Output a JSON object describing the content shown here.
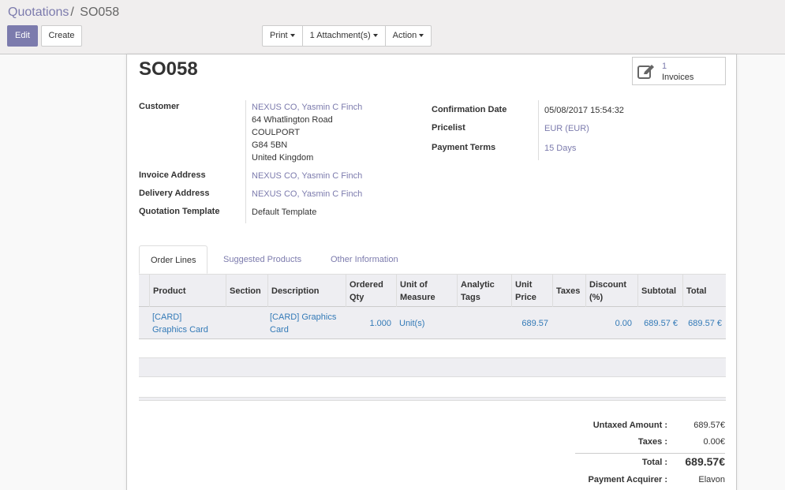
{
  "breadcrumb": {
    "parent": "Quotations",
    "separator": "/",
    "current": "SO058"
  },
  "toolbar": {
    "edit": "Edit",
    "create": "Create",
    "print": "Print",
    "attachments": "1 Attachment(s)",
    "action": "Action"
  },
  "record": {
    "title": "SO058",
    "stat_invoices_count": "1",
    "stat_invoices_label": "Invoices"
  },
  "left_fields": {
    "customer_label": "Customer",
    "customer_name": "NEXUS CO, Yasmin C Finch",
    "address_line1": "64 Whatlington Road",
    "address_line2": "COULPORT",
    "address_line3": "G84 5BN",
    "address_line4": "United Kingdom",
    "invoice_address_label": "Invoice Address",
    "invoice_address": "NEXUS CO, Yasmin C Finch",
    "delivery_address_label": "Delivery Address",
    "delivery_address": "NEXUS CO, Yasmin C Finch",
    "template_label": "Quotation Template",
    "template": "Default Template"
  },
  "right_fields": {
    "confirmation_label": "Confirmation Date",
    "confirmation": "05/08/2017 15:54:32",
    "pricelist_label": "Pricelist",
    "pricelist": "EUR (EUR)",
    "payment_terms_label": "Payment Terms",
    "payment_terms": "15 Days"
  },
  "tabs": [
    "Order Lines",
    "Suggested Products",
    "Other Information"
  ],
  "table": {
    "headers": {
      "product": "Product",
      "section": "Section",
      "description": "Description",
      "qty_1": "Ordered",
      "qty_2": "Qty",
      "uom_1": "Unit of",
      "uom_2": "Measure",
      "tags_1": "Analytic",
      "tags_2": "Tags",
      "price_1": "Unit",
      "price_2": "Price",
      "taxes": "Taxes",
      "disc_1": "Discount",
      "disc_2": "(%)",
      "subtotal": "Subtotal",
      "total": "Total"
    },
    "row": {
      "product_1": "[CARD]",
      "product_2": "Graphics Card",
      "description_1": "[CARD] Graphics",
      "description_2": "Card",
      "qty": "1.000",
      "uom": "Unit(s)",
      "price": "689.57",
      "discount": "0.00",
      "subtotal": "689.57 €",
      "total": "689.57 €"
    }
  },
  "totals": {
    "untaxed_label": "Untaxed Amount :",
    "untaxed": "689.57€",
    "taxes_label": "Taxes :",
    "taxes": "0.00€",
    "total_label": "Total :",
    "total": "689.57€",
    "acquirer_label": "Payment Acquirer :",
    "acquirer": "Elavon"
  },
  "colors": {
    "accent": "#7c7bad",
    "link_blue": "#337ab7",
    "header_bg": "#f0eeee",
    "row_bg": "#eeeef2"
  }
}
